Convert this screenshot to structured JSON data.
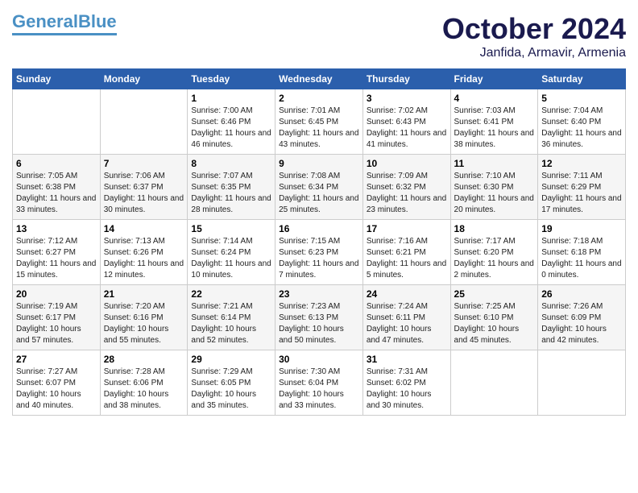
{
  "header": {
    "logo_line1": "General",
    "logo_line2": "Blue",
    "month": "October 2024",
    "location": "Janfida, Armavir, Armenia"
  },
  "days_of_week": [
    "Sunday",
    "Monday",
    "Tuesday",
    "Wednesday",
    "Thursday",
    "Friday",
    "Saturday"
  ],
  "weeks": [
    [
      {
        "day": "",
        "detail": ""
      },
      {
        "day": "",
        "detail": ""
      },
      {
        "day": "1",
        "detail": "Sunrise: 7:00 AM\nSunset: 6:46 PM\nDaylight: 11 hours\nand 46 minutes."
      },
      {
        "day": "2",
        "detail": "Sunrise: 7:01 AM\nSunset: 6:45 PM\nDaylight: 11 hours\nand 43 minutes."
      },
      {
        "day": "3",
        "detail": "Sunrise: 7:02 AM\nSunset: 6:43 PM\nDaylight: 11 hours\nand 41 minutes."
      },
      {
        "day": "4",
        "detail": "Sunrise: 7:03 AM\nSunset: 6:41 PM\nDaylight: 11 hours\nand 38 minutes."
      },
      {
        "day": "5",
        "detail": "Sunrise: 7:04 AM\nSunset: 6:40 PM\nDaylight: 11 hours\nand 36 minutes."
      }
    ],
    [
      {
        "day": "6",
        "detail": "Sunrise: 7:05 AM\nSunset: 6:38 PM\nDaylight: 11 hours\nand 33 minutes."
      },
      {
        "day": "7",
        "detail": "Sunrise: 7:06 AM\nSunset: 6:37 PM\nDaylight: 11 hours\nand 30 minutes."
      },
      {
        "day": "8",
        "detail": "Sunrise: 7:07 AM\nSunset: 6:35 PM\nDaylight: 11 hours\nand 28 minutes."
      },
      {
        "day": "9",
        "detail": "Sunrise: 7:08 AM\nSunset: 6:34 PM\nDaylight: 11 hours\nand 25 minutes."
      },
      {
        "day": "10",
        "detail": "Sunrise: 7:09 AM\nSunset: 6:32 PM\nDaylight: 11 hours\nand 23 minutes."
      },
      {
        "day": "11",
        "detail": "Sunrise: 7:10 AM\nSunset: 6:30 PM\nDaylight: 11 hours\nand 20 minutes."
      },
      {
        "day": "12",
        "detail": "Sunrise: 7:11 AM\nSunset: 6:29 PM\nDaylight: 11 hours\nand 17 minutes."
      }
    ],
    [
      {
        "day": "13",
        "detail": "Sunrise: 7:12 AM\nSunset: 6:27 PM\nDaylight: 11 hours\nand 15 minutes."
      },
      {
        "day": "14",
        "detail": "Sunrise: 7:13 AM\nSunset: 6:26 PM\nDaylight: 11 hours\nand 12 minutes."
      },
      {
        "day": "15",
        "detail": "Sunrise: 7:14 AM\nSunset: 6:24 PM\nDaylight: 11 hours\nand 10 minutes."
      },
      {
        "day": "16",
        "detail": "Sunrise: 7:15 AM\nSunset: 6:23 PM\nDaylight: 11 hours\nand 7 minutes."
      },
      {
        "day": "17",
        "detail": "Sunrise: 7:16 AM\nSunset: 6:21 PM\nDaylight: 11 hours\nand 5 minutes."
      },
      {
        "day": "18",
        "detail": "Sunrise: 7:17 AM\nSunset: 6:20 PM\nDaylight: 11 hours\nand 2 minutes."
      },
      {
        "day": "19",
        "detail": "Sunrise: 7:18 AM\nSunset: 6:18 PM\nDaylight: 11 hours\nand 0 minutes."
      }
    ],
    [
      {
        "day": "20",
        "detail": "Sunrise: 7:19 AM\nSunset: 6:17 PM\nDaylight: 10 hours\nand 57 minutes."
      },
      {
        "day": "21",
        "detail": "Sunrise: 7:20 AM\nSunset: 6:16 PM\nDaylight: 10 hours\nand 55 minutes."
      },
      {
        "day": "22",
        "detail": "Sunrise: 7:21 AM\nSunset: 6:14 PM\nDaylight: 10 hours\nand 52 minutes."
      },
      {
        "day": "23",
        "detail": "Sunrise: 7:23 AM\nSunset: 6:13 PM\nDaylight: 10 hours\nand 50 minutes."
      },
      {
        "day": "24",
        "detail": "Sunrise: 7:24 AM\nSunset: 6:11 PM\nDaylight: 10 hours\nand 47 minutes."
      },
      {
        "day": "25",
        "detail": "Sunrise: 7:25 AM\nSunset: 6:10 PM\nDaylight: 10 hours\nand 45 minutes."
      },
      {
        "day": "26",
        "detail": "Sunrise: 7:26 AM\nSunset: 6:09 PM\nDaylight: 10 hours\nand 42 minutes."
      }
    ],
    [
      {
        "day": "27",
        "detail": "Sunrise: 7:27 AM\nSunset: 6:07 PM\nDaylight: 10 hours\nand 40 minutes."
      },
      {
        "day": "28",
        "detail": "Sunrise: 7:28 AM\nSunset: 6:06 PM\nDaylight: 10 hours\nand 38 minutes."
      },
      {
        "day": "29",
        "detail": "Sunrise: 7:29 AM\nSunset: 6:05 PM\nDaylight: 10 hours\nand 35 minutes."
      },
      {
        "day": "30",
        "detail": "Sunrise: 7:30 AM\nSunset: 6:04 PM\nDaylight: 10 hours\nand 33 minutes."
      },
      {
        "day": "31",
        "detail": "Sunrise: 7:31 AM\nSunset: 6:02 PM\nDaylight: 10 hours\nand 30 minutes."
      },
      {
        "day": "",
        "detail": ""
      },
      {
        "day": "",
        "detail": ""
      }
    ]
  ]
}
